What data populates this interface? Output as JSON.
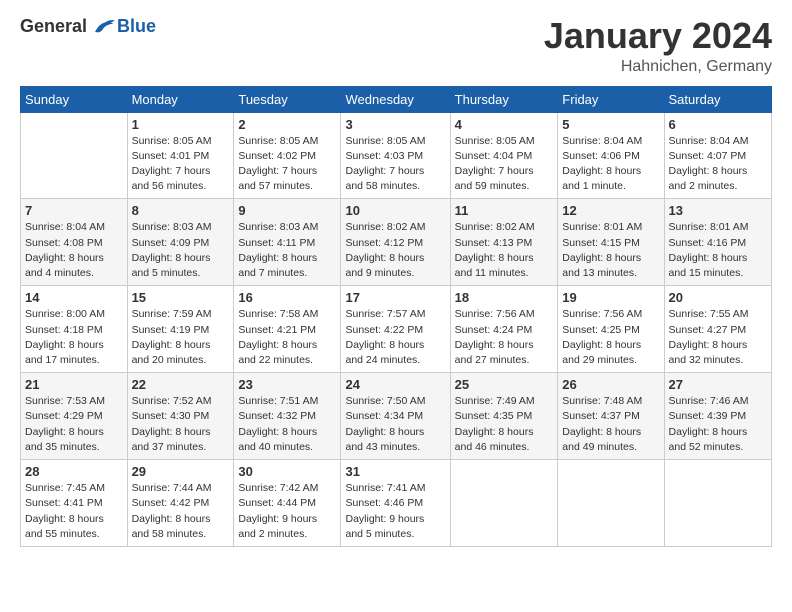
{
  "header": {
    "logo_general": "General",
    "logo_blue": "Blue",
    "month_title": "January 2024",
    "location": "Hahnichen, Germany"
  },
  "weekdays": [
    "Sunday",
    "Monday",
    "Tuesday",
    "Wednesday",
    "Thursday",
    "Friday",
    "Saturday"
  ],
  "weeks": [
    [
      {
        "day": "",
        "info": ""
      },
      {
        "day": "1",
        "info": "Sunrise: 8:05 AM\nSunset: 4:01 PM\nDaylight: 7 hours\nand 56 minutes."
      },
      {
        "day": "2",
        "info": "Sunrise: 8:05 AM\nSunset: 4:02 PM\nDaylight: 7 hours\nand 57 minutes."
      },
      {
        "day": "3",
        "info": "Sunrise: 8:05 AM\nSunset: 4:03 PM\nDaylight: 7 hours\nand 58 minutes."
      },
      {
        "day": "4",
        "info": "Sunrise: 8:05 AM\nSunset: 4:04 PM\nDaylight: 7 hours\nand 59 minutes."
      },
      {
        "day": "5",
        "info": "Sunrise: 8:04 AM\nSunset: 4:06 PM\nDaylight: 8 hours\nand 1 minute."
      },
      {
        "day": "6",
        "info": "Sunrise: 8:04 AM\nSunset: 4:07 PM\nDaylight: 8 hours\nand 2 minutes."
      }
    ],
    [
      {
        "day": "7",
        "info": "Sunrise: 8:04 AM\nSunset: 4:08 PM\nDaylight: 8 hours\nand 4 minutes."
      },
      {
        "day": "8",
        "info": "Sunrise: 8:03 AM\nSunset: 4:09 PM\nDaylight: 8 hours\nand 5 minutes."
      },
      {
        "day": "9",
        "info": "Sunrise: 8:03 AM\nSunset: 4:11 PM\nDaylight: 8 hours\nand 7 minutes."
      },
      {
        "day": "10",
        "info": "Sunrise: 8:02 AM\nSunset: 4:12 PM\nDaylight: 8 hours\nand 9 minutes."
      },
      {
        "day": "11",
        "info": "Sunrise: 8:02 AM\nSunset: 4:13 PM\nDaylight: 8 hours\nand 11 minutes."
      },
      {
        "day": "12",
        "info": "Sunrise: 8:01 AM\nSunset: 4:15 PM\nDaylight: 8 hours\nand 13 minutes."
      },
      {
        "day": "13",
        "info": "Sunrise: 8:01 AM\nSunset: 4:16 PM\nDaylight: 8 hours\nand 15 minutes."
      }
    ],
    [
      {
        "day": "14",
        "info": "Sunrise: 8:00 AM\nSunset: 4:18 PM\nDaylight: 8 hours\nand 17 minutes."
      },
      {
        "day": "15",
        "info": "Sunrise: 7:59 AM\nSunset: 4:19 PM\nDaylight: 8 hours\nand 20 minutes."
      },
      {
        "day": "16",
        "info": "Sunrise: 7:58 AM\nSunset: 4:21 PM\nDaylight: 8 hours\nand 22 minutes."
      },
      {
        "day": "17",
        "info": "Sunrise: 7:57 AM\nSunset: 4:22 PM\nDaylight: 8 hours\nand 24 minutes."
      },
      {
        "day": "18",
        "info": "Sunrise: 7:56 AM\nSunset: 4:24 PM\nDaylight: 8 hours\nand 27 minutes."
      },
      {
        "day": "19",
        "info": "Sunrise: 7:56 AM\nSunset: 4:25 PM\nDaylight: 8 hours\nand 29 minutes."
      },
      {
        "day": "20",
        "info": "Sunrise: 7:55 AM\nSunset: 4:27 PM\nDaylight: 8 hours\nand 32 minutes."
      }
    ],
    [
      {
        "day": "21",
        "info": "Sunrise: 7:53 AM\nSunset: 4:29 PM\nDaylight: 8 hours\nand 35 minutes."
      },
      {
        "day": "22",
        "info": "Sunrise: 7:52 AM\nSunset: 4:30 PM\nDaylight: 8 hours\nand 37 minutes."
      },
      {
        "day": "23",
        "info": "Sunrise: 7:51 AM\nSunset: 4:32 PM\nDaylight: 8 hours\nand 40 minutes."
      },
      {
        "day": "24",
        "info": "Sunrise: 7:50 AM\nSunset: 4:34 PM\nDaylight: 8 hours\nand 43 minutes."
      },
      {
        "day": "25",
        "info": "Sunrise: 7:49 AM\nSunset: 4:35 PM\nDaylight: 8 hours\nand 46 minutes."
      },
      {
        "day": "26",
        "info": "Sunrise: 7:48 AM\nSunset: 4:37 PM\nDaylight: 8 hours\nand 49 minutes."
      },
      {
        "day": "27",
        "info": "Sunrise: 7:46 AM\nSunset: 4:39 PM\nDaylight: 8 hours\nand 52 minutes."
      }
    ],
    [
      {
        "day": "28",
        "info": "Sunrise: 7:45 AM\nSunset: 4:41 PM\nDaylight: 8 hours\nand 55 minutes."
      },
      {
        "day": "29",
        "info": "Sunrise: 7:44 AM\nSunset: 4:42 PM\nDaylight: 8 hours\nand 58 minutes."
      },
      {
        "day": "30",
        "info": "Sunrise: 7:42 AM\nSunset: 4:44 PM\nDaylight: 9 hours\nand 2 minutes."
      },
      {
        "day": "31",
        "info": "Sunrise: 7:41 AM\nSunset: 4:46 PM\nDaylight: 9 hours\nand 5 minutes."
      },
      {
        "day": "",
        "info": ""
      },
      {
        "day": "",
        "info": ""
      },
      {
        "day": "",
        "info": ""
      }
    ]
  ]
}
